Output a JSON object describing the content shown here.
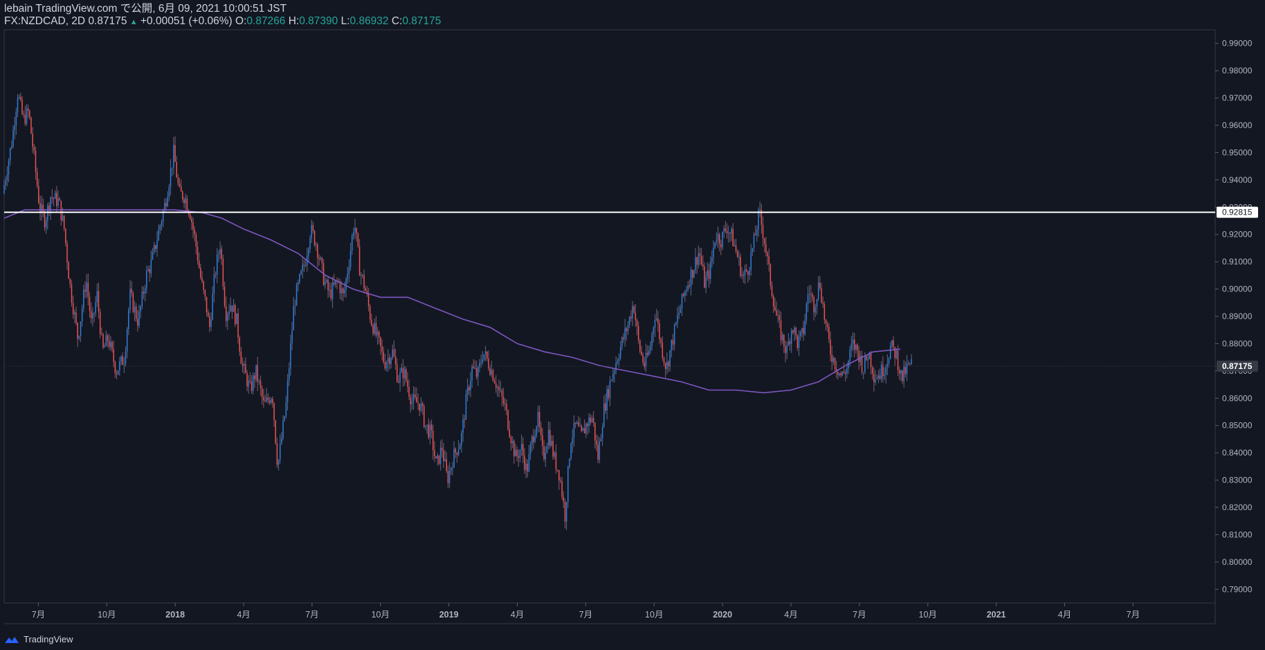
{
  "header": {
    "line1": "lebain TradingView.com で公開, 6月 09, 2021 10:00:51 JST",
    "symbol": "FX:NZDCAD, 2D",
    "last": "0.87175",
    "arrow": "▲",
    "change": "+0.00051 (+0.06%)",
    "o_label": "O:",
    "o_val": "0.87266",
    "h_label": "H:",
    "h_val": "0.87390",
    "l_label": "L:",
    "l_val": "0.86932",
    "c_label": "C:",
    "c_val": "0.87175"
  },
  "footer": {
    "brand": "TradingView"
  },
  "colors": {
    "background": "#131722",
    "up": "#2f7fdc",
    "down": "#ef5350",
    "ma": "#7e57c2",
    "hline": "#ffffff",
    "axis_text": "#b2b5be",
    "grid": "#2a2e39"
  },
  "chart_data": {
    "type": "candlestick",
    "symbol": "FX:NZDCAD",
    "interval": "2D",
    "ylim": [
      0.785,
      0.995
    ],
    "y_ticks": [
      "0.99000",
      "0.98000",
      "0.97000",
      "0.96000",
      "0.95000",
      "0.94000",
      "0.93000",
      "0.92000",
      "0.91000",
      "0.90000",
      "0.89000",
      "0.88000",
      "0.87000",
      "0.86000",
      "0.85000",
      "0.84000",
      "0.83000",
      "0.82000",
      "0.81000",
      "0.80000",
      "0.79000"
    ],
    "x_ticks": [
      {
        "label": "7月",
        "t": 2017.5
      },
      {
        "label": "10月",
        "t": 2017.75
      },
      {
        "label": "2018",
        "t": 2018.0
      },
      {
        "label": "4月",
        "t": 2018.25
      },
      {
        "label": "7月",
        "t": 2018.5
      },
      {
        "label": "10月",
        "t": 2018.75
      },
      {
        "label": "2019",
        "t": 2019.0
      },
      {
        "label": "4月",
        "t": 2019.25
      },
      {
        "label": "7月",
        "t": 2019.5
      },
      {
        "label": "10月",
        "t": 2019.75
      },
      {
        "label": "2020",
        "t": 2020.0
      },
      {
        "label": "4月",
        "t": 2020.25
      },
      {
        "label": "7月",
        "t": 2020.5
      },
      {
        "label": "10月",
        "t": 2020.75
      },
      {
        "label": "2021",
        "t": 2021.0
      },
      {
        "label": "4月",
        "t": 2021.25
      },
      {
        "label": "7月",
        "t": 2021.5
      }
    ],
    "xlim": [
      2017.375,
      2021.8
    ],
    "price_path": [
      [
        2017.375,
        0.935
      ],
      [
        2017.41,
        0.955
      ],
      [
        2017.43,
        0.972
      ],
      [
        2017.45,
        0.962
      ],
      [
        2017.47,
        0.965
      ],
      [
        2017.49,
        0.948
      ],
      [
        2017.51,
        0.93
      ],
      [
        2017.53,
        0.925
      ],
      [
        2017.55,
        0.934
      ],
      [
        2017.58,
        0.932
      ],
      [
        2017.6,
        0.922
      ],
      [
        2017.62,
        0.902
      ],
      [
        2017.65,
        0.882
      ],
      [
        2017.68,
        0.904
      ],
      [
        2017.7,
        0.886
      ],
      [
        2017.72,
        0.898
      ],
      [
        2017.74,
        0.877
      ],
      [
        2017.76,
        0.882
      ],
      [
        2017.79,
        0.87
      ],
      [
        2017.82,
        0.875
      ],
      [
        2017.84,
        0.898
      ],
      [
        2017.87,
        0.888
      ],
      [
        2017.9,
        0.905
      ],
      [
        2017.92,
        0.91
      ],
      [
        2017.94,
        0.919
      ],
      [
        2017.97,
        0.932
      ],
      [
        2018.0,
        0.95
      ],
      [
        2018.02,
        0.935
      ],
      [
        2018.04,
        0.934
      ],
      [
        2018.06,
        0.928
      ],
      [
        2018.08,
        0.917
      ],
      [
        2018.1,
        0.903
      ],
      [
        2018.12,
        0.893
      ],
      [
        2018.13,
        0.885
      ],
      [
        2018.15,
        0.905
      ],
      [
        2018.17,
        0.917
      ],
      [
        2018.19,
        0.891
      ],
      [
        2018.21,
        0.895
      ],
      [
        2018.23,
        0.888
      ],
      [
        2018.25,
        0.872
      ],
      [
        2018.28,
        0.863
      ],
      [
        2018.3,
        0.87
      ],
      [
        2018.33,
        0.857
      ],
      [
        2018.36,
        0.862
      ],
      [
        2018.38,
        0.835
      ],
      [
        2018.41,
        0.857
      ],
      [
        2018.44,
        0.895
      ],
      [
        2018.46,
        0.903
      ],
      [
        2018.48,
        0.91
      ],
      [
        2018.5,
        0.922
      ],
      [
        2018.52,
        0.917
      ],
      [
        2018.55,
        0.903
      ],
      [
        2018.57,
        0.898
      ],
      [
        2018.6,
        0.903
      ],
      [
        2018.62,
        0.897
      ],
      [
        2018.64,
        0.91
      ],
      [
        2018.66,
        0.925
      ],
      [
        2018.68,
        0.907
      ],
      [
        2018.7,
        0.9
      ],
      [
        2018.72,
        0.889
      ],
      [
        2018.75,
        0.88
      ],
      [
        2018.77,
        0.873
      ],
      [
        2018.8,
        0.877
      ],
      [
        2018.82,
        0.867
      ],
      [
        2018.84,
        0.87
      ],
      [
        2018.87,
        0.859
      ],
      [
        2018.9,
        0.858
      ],
      [
        2018.92,
        0.85
      ],
      [
        2018.94,
        0.847
      ],
      [
        2018.96,
        0.835
      ],
      [
        2018.98,
        0.842
      ],
      [
        2019.0,
        0.83
      ],
      [
        2019.02,
        0.838
      ],
      [
        2019.05,
        0.845
      ],
      [
        2019.07,
        0.86
      ],
      [
        2019.09,
        0.871
      ],
      [
        2019.11,
        0.868
      ],
      [
        2019.13,
        0.877
      ],
      [
        2019.15,
        0.873
      ],
      [
        2019.17,
        0.868
      ],
      [
        2019.19,
        0.862
      ],
      [
        2019.21,
        0.857
      ],
      [
        2019.23,
        0.847
      ],
      [
        2019.25,
        0.838
      ],
      [
        2019.27,
        0.842
      ],
      [
        2019.29,
        0.833
      ],
      [
        2019.31,
        0.845
      ],
      [
        2019.33,
        0.853
      ],
      [
        2019.35,
        0.838
      ],
      [
        2019.37,
        0.848
      ],
      [
        2019.39,
        0.838
      ],
      [
        2019.41,
        0.832
      ],
      [
        2019.43,
        0.817
      ],
      [
        2019.45,
        0.845
      ],
      [
        2019.47,
        0.85
      ],
      [
        2019.49,
        0.846
      ],
      [
        2019.51,
        0.851
      ],
      [
        2019.53,
        0.853
      ],
      [
        2019.55,
        0.838
      ],
      [
        2019.57,
        0.855
      ],
      [
        2019.6,
        0.868
      ],
      [
        2019.63,
        0.878
      ],
      [
        2019.66,
        0.887
      ],
      [
        2019.68,
        0.895
      ],
      [
        2019.7,
        0.879
      ],
      [
        2019.72,
        0.872
      ],
      [
        2019.74,
        0.878
      ],
      [
        2019.76,
        0.892
      ],
      [
        2019.78,
        0.88
      ],
      [
        2019.8,
        0.871
      ],
      [
        2019.82,
        0.88
      ],
      [
        2019.84,
        0.889
      ],
      [
        2019.87,
        0.9
      ],
      [
        2019.9,
        0.908
      ],
      [
        2019.92,
        0.914
      ],
      [
        2019.94,
        0.902
      ],
      [
        2019.96,
        0.907
      ],
      [
        2019.98,
        0.92
      ],
      [
        2020.0,
        0.918
      ],
      [
        2020.02,
        0.923
      ],
      [
        2020.04,
        0.919
      ],
      [
        2020.06,
        0.912
      ],
      [
        2020.08,
        0.904
      ],
      [
        2020.1,
        0.908
      ],
      [
        2020.12,
        0.917
      ],
      [
        2020.14,
        0.928
      ],
      [
        2020.16,
        0.917
      ],
      [
        2020.18,
        0.903
      ],
      [
        2020.2,
        0.891
      ],
      [
        2020.22,
        0.883
      ],
      [
        2020.24,
        0.877
      ],
      [
        2020.26,
        0.887
      ],
      [
        2020.28,
        0.88
      ],
      [
        2020.3,
        0.884
      ],
      [
        2020.32,
        0.9
      ],
      [
        2020.34,
        0.894
      ],
      [
        2020.36,
        0.903
      ],
      [
        2020.38,
        0.888
      ],
      [
        2020.4,
        0.877
      ],
      [
        2020.42,
        0.872
      ],
      [
        2020.44,
        0.868
      ],
      [
        2020.46,
        0.871
      ],
      [
        2020.48,
        0.88
      ],
      [
        2020.5,
        0.877
      ],
      [
        2020.52,
        0.871
      ],
      [
        2020.54,
        0.877
      ],
      [
        2020.56,
        0.868
      ],
      [
        2020.58,
        0.869
      ],
      [
        2020.6,
        0.872
      ],
      [
        2020.62,
        0.879
      ],
      [
        2020.64,
        0.876
      ],
      [
        2020.66,
        0.867
      ],
      [
        2020.68,
        0.871
      ],
      [
        2020.7,
        0.873
      ]
    ],
    "moving_average": [
      [
        2017.375,
        0.926
      ],
      [
        2017.45,
        0.929
      ],
      [
        2017.55,
        0.929
      ],
      [
        2017.7,
        0.929
      ],
      [
        2017.9,
        0.929
      ],
      [
        2018.0,
        0.929
      ],
      [
        2018.1,
        0.928
      ],
      [
        2018.17,
        0.926
      ],
      [
        2018.25,
        0.922
      ],
      [
        2018.35,
        0.918
      ],
      [
        2018.45,
        0.913
      ],
      [
        2018.55,
        0.905
      ],
      [
        2018.65,
        0.9
      ],
      [
        2018.75,
        0.897
      ],
      [
        2018.85,
        0.897
      ],
      [
        2018.95,
        0.893
      ],
      [
        2019.05,
        0.889
      ],
      [
        2019.15,
        0.886
      ],
      [
        2019.25,
        0.88
      ],
      [
        2019.35,
        0.877
      ],
      [
        2019.45,
        0.875
      ],
      [
        2019.55,
        0.872
      ],
      [
        2019.65,
        0.87
      ],
      [
        2019.75,
        0.868
      ],
      [
        2019.85,
        0.866
      ],
      [
        2019.95,
        0.863
      ],
      [
        2020.05,
        0.863
      ],
      [
        2020.15,
        0.862
      ],
      [
        2020.25,
        0.863
      ],
      [
        2020.35,
        0.866
      ],
      [
        2020.45,
        0.872
      ],
      [
        2020.55,
        0.877
      ],
      [
        2020.65,
        0.878
      ]
    ],
    "horizontal_line": 0.92815,
    "last_price": 0.87175
  }
}
